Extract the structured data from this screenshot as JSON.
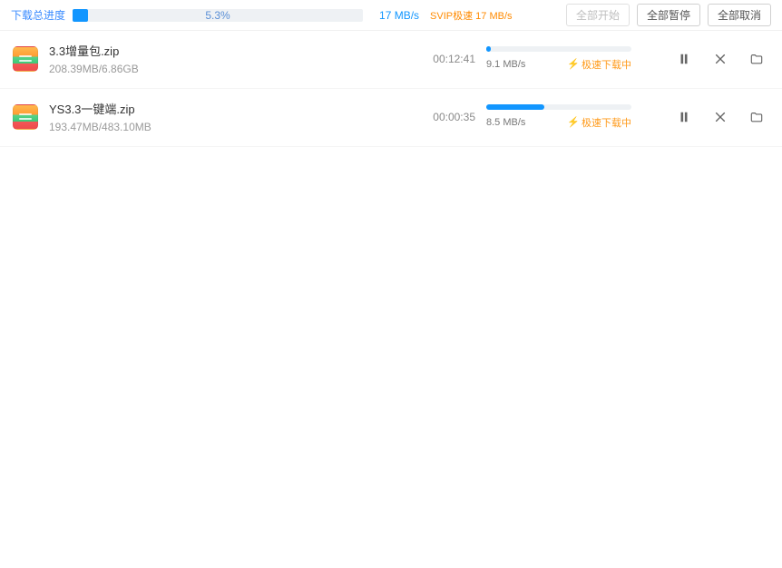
{
  "header": {
    "label": "下载总进度",
    "progress_percent": 5.3,
    "progress_text": "5.3%",
    "speed": "17 MB/s",
    "svip_text": "SVIP极速 17 MB/s",
    "start_all": "全部开始",
    "pause_all": "全部暂停",
    "cancel_all": "全部取消"
  },
  "downloads": [
    {
      "name": "3.3增量包.zip",
      "size": "208.39MB/6.86GB",
      "eta": "00:12:41",
      "progress_percent": 3,
      "speed": "9.1 MB/s",
      "status": "极速下载中"
    },
    {
      "name": "YS3.3一键端.zip",
      "size": "193.47MB/483.10MB",
      "eta": "00:00:35",
      "progress_percent": 40,
      "speed": "8.5 MB/s",
      "status": "极速下载中"
    }
  ]
}
